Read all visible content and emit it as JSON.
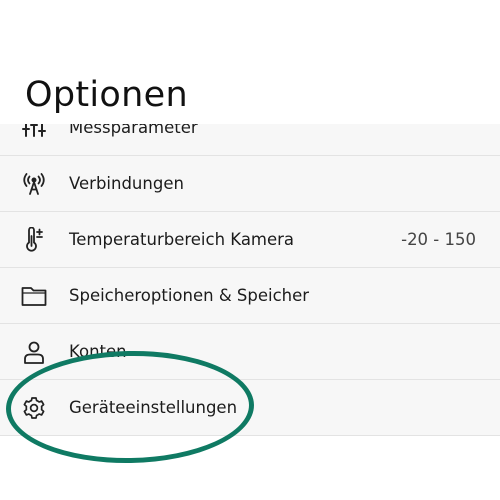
{
  "header": {
    "title": "Optionen"
  },
  "menu": {
    "items": [
      {
        "label": "Messparameter",
        "icon": "sliders-icon",
        "value": ""
      },
      {
        "label": "Verbindungen",
        "icon": "antenna-icon",
        "value": ""
      },
      {
        "label": "Temperaturbereich Kamera",
        "icon": "thermometer-icon",
        "value": "-20 - 150"
      },
      {
        "label": "Speicheroptionen & Speicher",
        "icon": "folder-icon",
        "value": ""
      },
      {
        "label": "Konten",
        "icon": "person-icon",
        "value": ""
      },
      {
        "label": "Geräteeinstellungen",
        "icon": "gear-icon",
        "value": ""
      }
    ]
  },
  "annotation": {
    "color": "#0f7a63",
    "target": "Geräteeinstellungen"
  }
}
